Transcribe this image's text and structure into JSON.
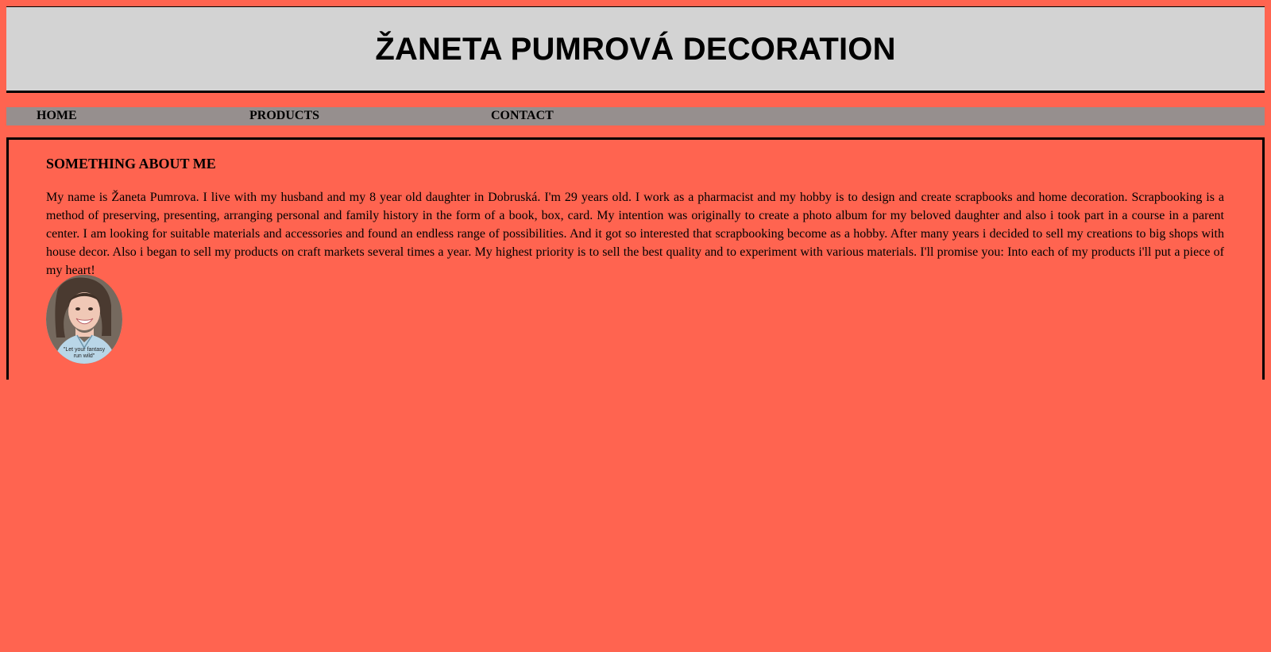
{
  "header": {
    "title": "ŽANETA PUMROVÁ DECORATION"
  },
  "nav": {
    "items": [
      {
        "label": "HOME"
      },
      {
        "label": "PRODUCTS"
      },
      {
        "label": "CONTACT"
      }
    ]
  },
  "main": {
    "heading": "SOMETHING ABOUT ME",
    "paragraph": "My name is Žaneta Pumrova. I live with my husband and my 8 year old daughter in Dobruská. I'm 29 years old. I work as a pharmacist and my hobby is to design and create scrapbooks and home decoration. Scrapbooking is a method of preserving, presenting, arranging personal and family history in the form of a book, box, card. My intention was originally to create a photo album for my beloved daughter and also i took part in a course in a parent center. I am looking for suitable materials and accessories and found an endless range of possibilities. And it got so interested that scrapbooking become as a hobby. After many years i decided to sell my creations to big shops with house decor. Also i began to sell my products on craft markets several times a year. My highest priority is to sell the best quality and to experiment with various materials. I'll promise you: Into each of my products i'll put a piece of my heart!",
    "avatar": {
      "caption": "Let your fantasy run wild"
    }
  },
  "colors": {
    "page_background": "#ff6450",
    "header_background": "#d3d3d3",
    "nav_background": "#968f8e",
    "border": "#000000"
  }
}
